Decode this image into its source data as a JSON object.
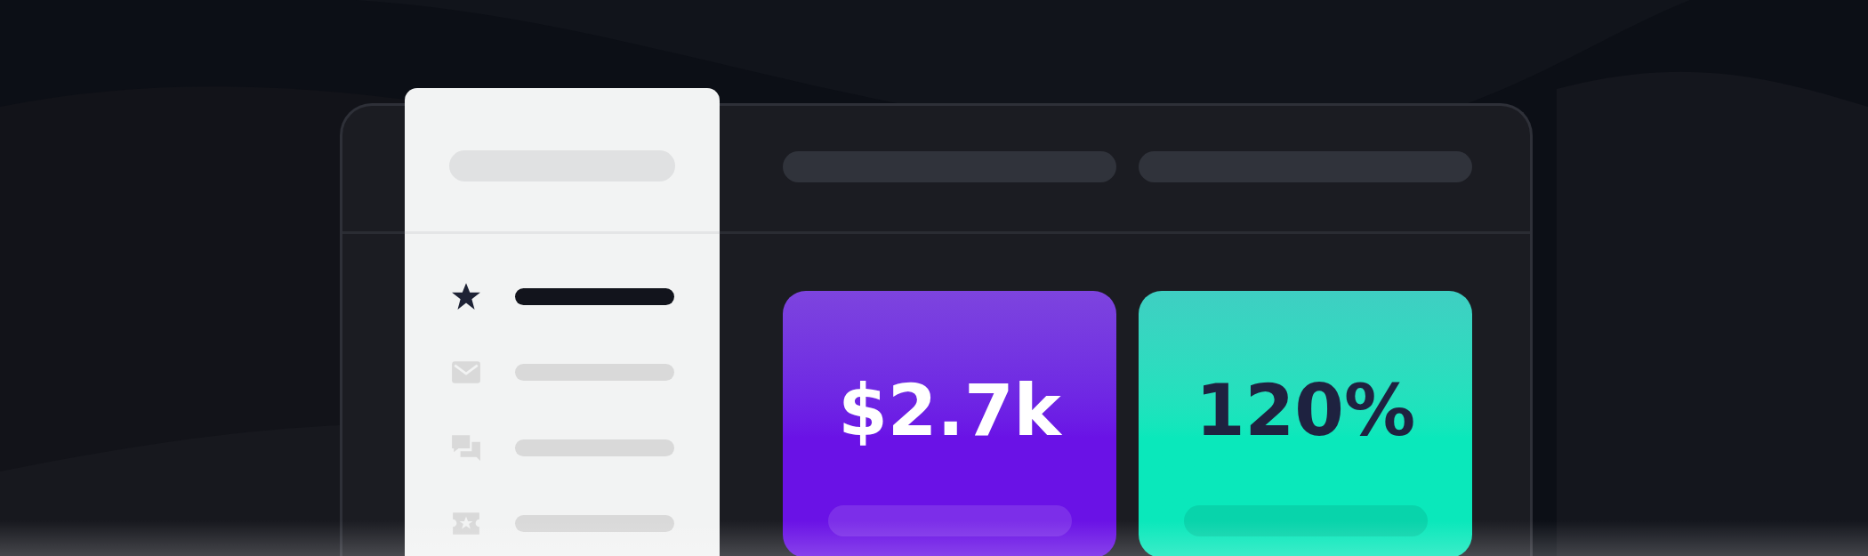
{
  "sidebar": {
    "items": [
      {
        "kind": "star",
        "selected": true
      },
      {
        "kind": "mail",
        "selected": false
      },
      {
        "kind": "chat",
        "selected": false
      },
      {
        "kind": "ticket",
        "selected": false
      }
    ]
  },
  "cards": [
    {
      "value": "$2.7k",
      "color": "#6a12e6"
    },
    {
      "value": "120%",
      "color": "#0ae8bb"
    }
  ]
}
